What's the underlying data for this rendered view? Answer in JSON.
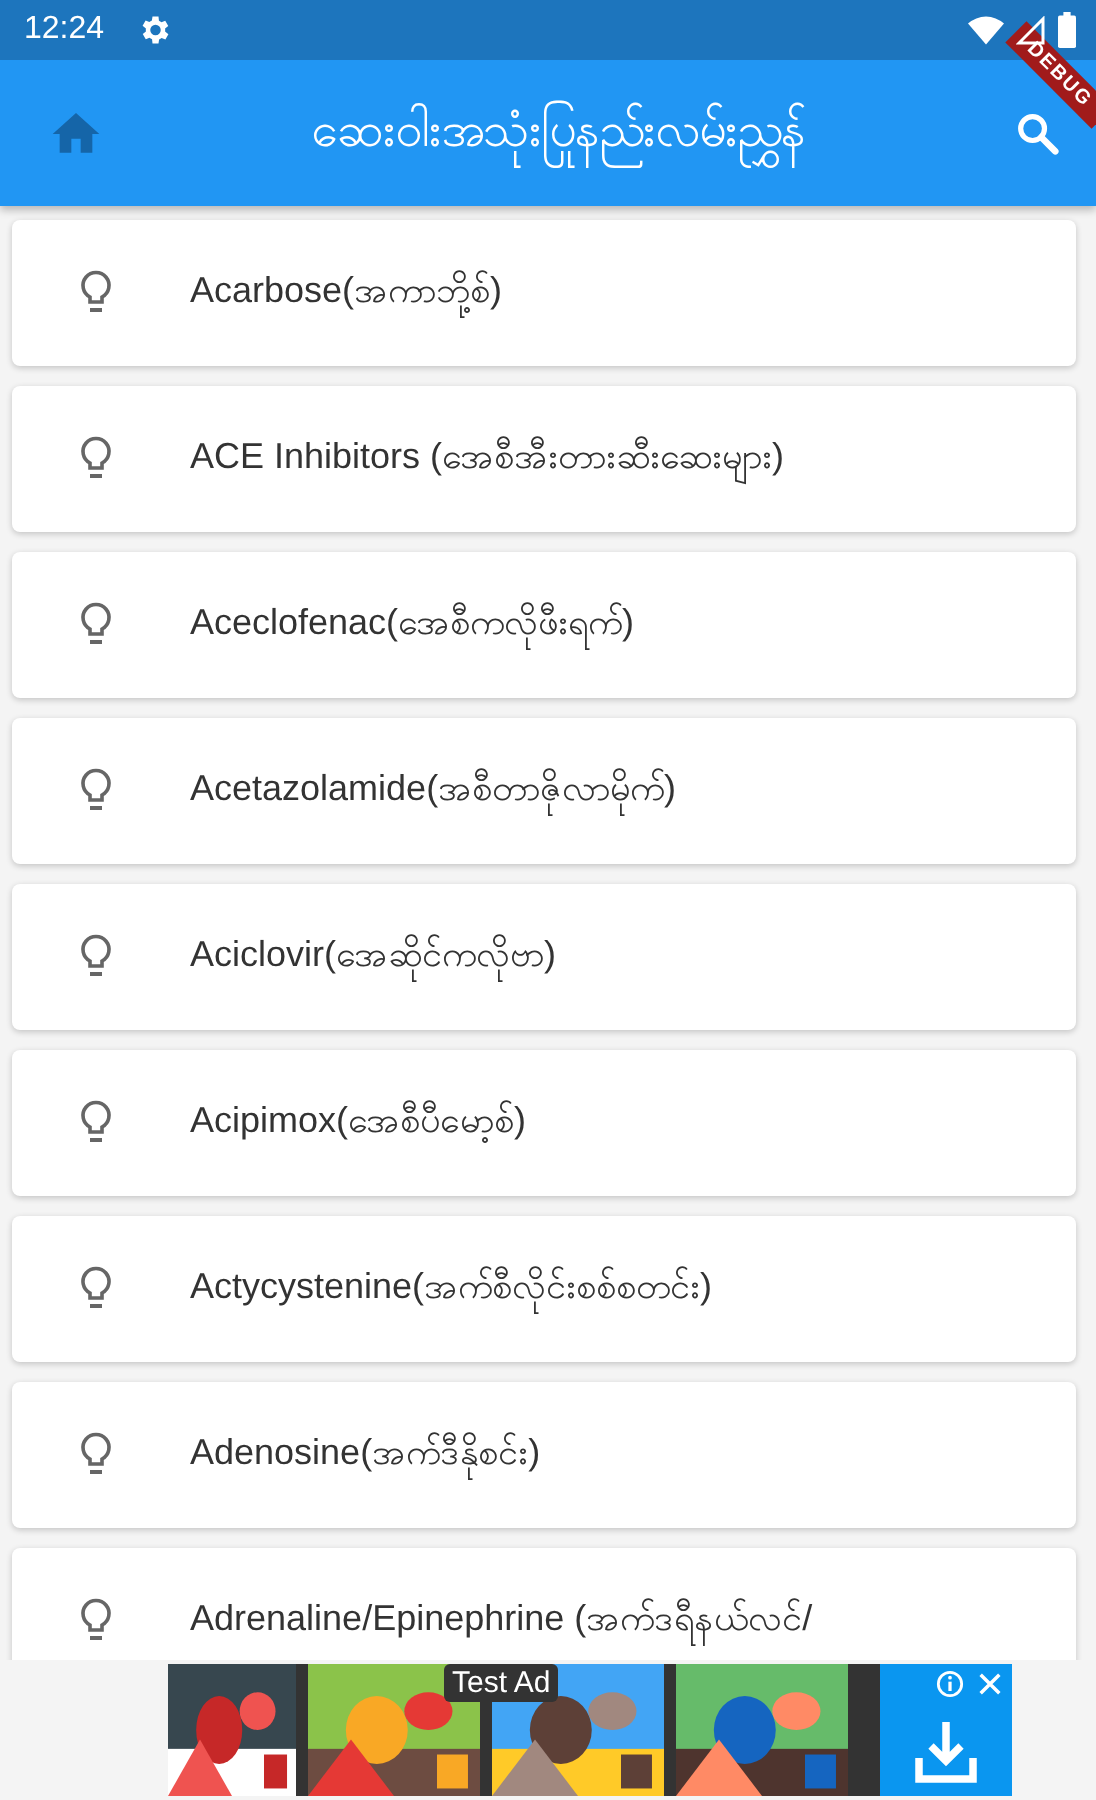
{
  "status_bar": {
    "time": "12:24"
  },
  "debug_banner": {
    "label": "DEBUG"
  },
  "app_bar": {
    "title": "ဆေးဝါးအသုံးပြုနည်းလမ်းညွှန်"
  },
  "drugs": [
    {
      "name": "Acarbose(အကာဘို့စ်)"
    },
    {
      "name": "ACE Inhibitors (အေစီအီးတားဆီးဆေးများ)"
    },
    {
      "name": "Aceclofenac(အေစီကလိုဖီးရက်)"
    },
    {
      "name": "Acetazolamide(အစီတာဇိုလာမိုက်)"
    },
    {
      "name": "Aciclovir(အေဆိုင်ကလိုဗာ)"
    },
    {
      "name": "Acipimox(အေစီပီမော့စ်)"
    },
    {
      "name": "Actycystenine(အက်စီလိုင်းစစ်စတင်း)"
    },
    {
      "name": "Adenosine(အက်ဒီနိုစင်း)"
    },
    {
      "name": "Adrenaline/Epinephrine  (အက်ဒရီနယ်လင်/"
    }
  ],
  "ad": {
    "label": "Test Ad"
  }
}
